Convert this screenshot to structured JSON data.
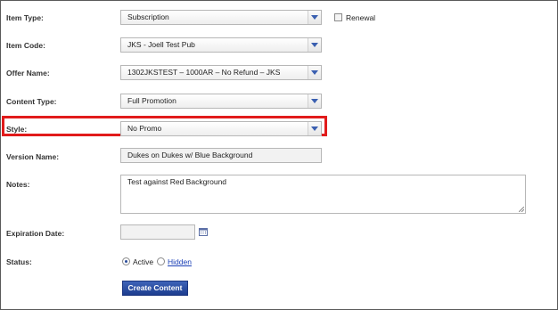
{
  "form": {
    "item_type": {
      "label": "Item Type:",
      "value": "Subscription"
    },
    "renewal": {
      "label": "Renewal",
      "checked": false
    },
    "item_code": {
      "label": "Item Code:",
      "value": "JKS - Joell Test Pub"
    },
    "offer_name": {
      "label": "Offer Name:",
      "value": "1302JKSTEST – 1000AR – No Refund – JKS"
    },
    "content_type": {
      "label": "Content Type:",
      "value": "Full Promotion"
    },
    "style": {
      "label": "Style:",
      "value": "No Promo"
    },
    "version_name": {
      "label": "Version Name:",
      "value": "Dukes on Dukes w/ Blue Background"
    },
    "notes": {
      "label": "Notes:",
      "value": "Test against Red Background"
    },
    "expiration_date": {
      "label": "Expiration Date:",
      "value": ""
    },
    "status": {
      "label": "Status:",
      "options": [
        {
          "label": "Active",
          "selected": true
        },
        {
          "label": "Hidden",
          "selected": false
        }
      ]
    },
    "submit_label": "Create Content"
  },
  "colors": {
    "highlight": "#e11b1b",
    "button": "#1c3d8f",
    "link": "#1a3fb6"
  },
  "icons": {
    "dropdown": "chevron-down-icon",
    "date_picker": "calendar-icon"
  }
}
